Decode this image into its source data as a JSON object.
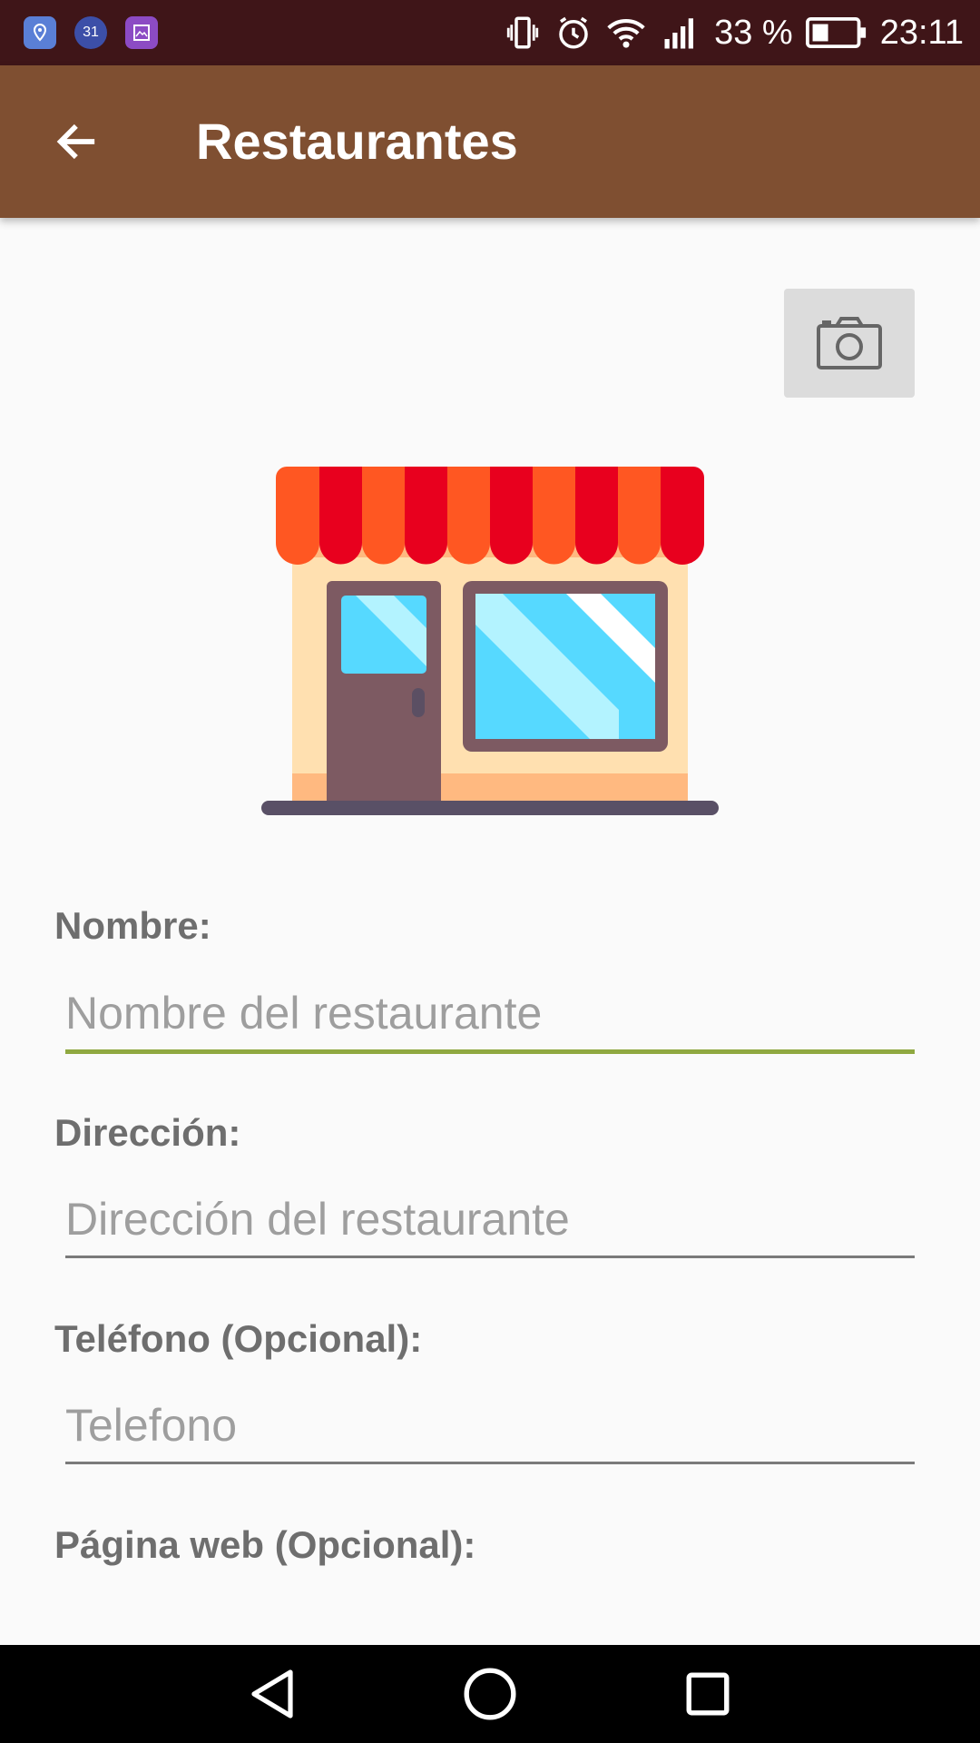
{
  "status_bar": {
    "battery_percent": "33 %",
    "time": "23:11",
    "notification_icons": [
      "maps-icon",
      "calendar-icon",
      "gallery-icon"
    ],
    "calendar_day": "31",
    "system_icons": [
      "vibrate-icon",
      "alarm-icon",
      "wifi-icon",
      "signal-icon",
      "battery-icon"
    ]
  },
  "app_bar": {
    "title": "Restaurantes",
    "background_color": "#7f4f31"
  },
  "form": {
    "nombre": {
      "label": "Nombre:",
      "placeholder": "Nombre del restaurante",
      "value": "",
      "focused": true
    },
    "direccion": {
      "label": "Dirección:",
      "placeholder": "Dirección del restaurante",
      "value": ""
    },
    "telefono": {
      "label": "Teléfono (Opcional):",
      "placeholder": "Telefono",
      "value": ""
    },
    "pagina_web": {
      "label": "Página web (Opcional):"
    }
  },
  "colors": {
    "accent_underline": "#8fa840",
    "status_bar": "#3f1518",
    "label_text": "#6e6e6e"
  }
}
